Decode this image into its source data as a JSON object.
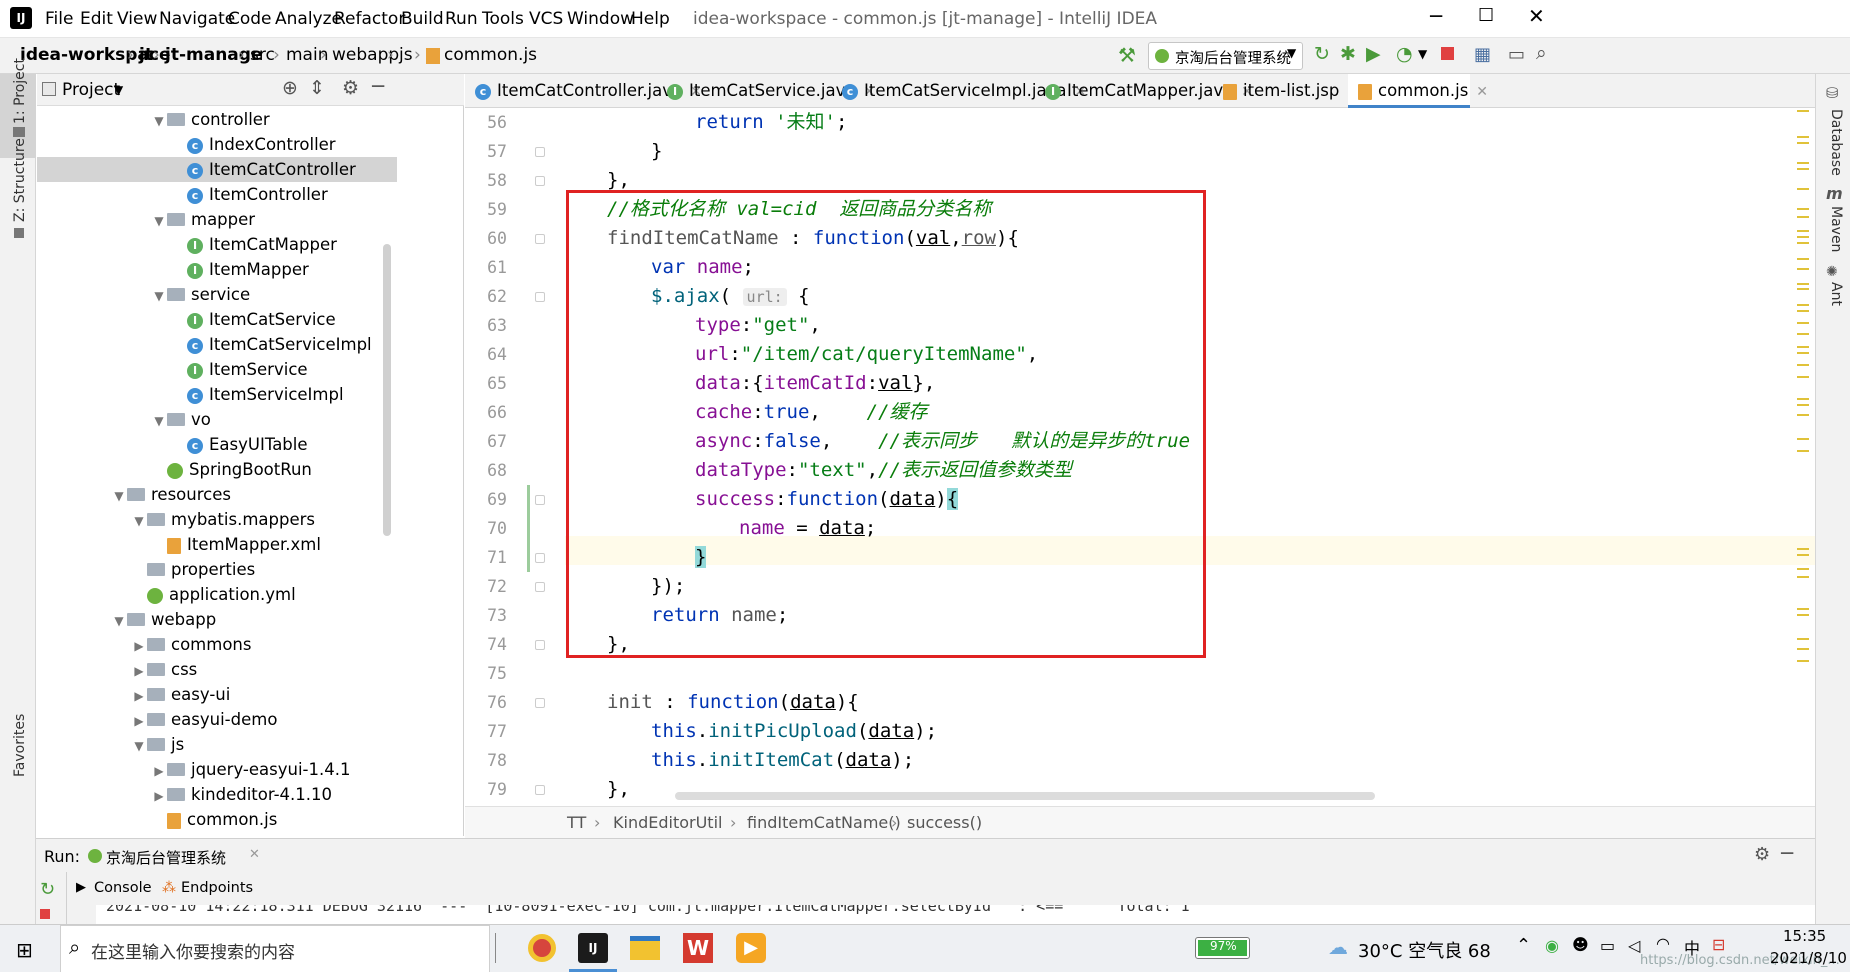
{
  "window": {
    "title": "idea-workspace - common.js [jt-manage] - IntelliJ IDEA",
    "menu": [
      "File",
      "Edit",
      "View",
      "Navigate",
      "Code",
      "Analyze",
      "Refactor",
      "Build",
      "Run",
      "Tools",
      "VCS",
      "Window",
      "Help"
    ]
  },
  "navbar": {
    "crumbs": [
      "idea-workspace",
      "jt",
      "jt-manage",
      "src",
      "main",
      "webapp",
      "js",
      "common.js"
    ],
    "run_config": "京淘后台管理系统"
  },
  "left_strip": {
    "project": "1: Project",
    "structure": "Z: Structure",
    "favorites": "Favorites"
  },
  "project_panel": {
    "title": "Project",
    "tree": [
      {
        "label": "controller",
        "icon": "folder",
        "depth": 3,
        "arrow": "▼"
      },
      {
        "label": "IndexController",
        "icon": "class",
        "depth": 4
      },
      {
        "label": "ItemCatController",
        "icon": "class",
        "depth": 4,
        "selected": true
      },
      {
        "label": "ItemController",
        "icon": "class",
        "depth": 4
      },
      {
        "label": "mapper",
        "icon": "folder",
        "depth": 3,
        "arrow": "▼"
      },
      {
        "label": "ItemCatMapper",
        "icon": "interface",
        "depth": 4
      },
      {
        "label": "ItemMapper",
        "icon": "interface",
        "depth": 4
      },
      {
        "label": "service",
        "icon": "folder",
        "depth": 3,
        "arrow": "▼"
      },
      {
        "label": "ItemCatService",
        "icon": "interface",
        "depth": 4
      },
      {
        "label": "ItemCatServiceImpl",
        "icon": "class",
        "depth": 4
      },
      {
        "label": "ItemService",
        "icon": "interface",
        "depth": 4
      },
      {
        "label": "ItemServiceImpl",
        "icon": "class",
        "depth": 4
      },
      {
        "label": "vo",
        "icon": "folder",
        "depth": 3,
        "arrow": "▼"
      },
      {
        "label": "EasyUITable",
        "icon": "class",
        "depth": 4
      },
      {
        "label": "SpringBootRun",
        "icon": "spring",
        "depth": 3
      },
      {
        "label": "resources",
        "icon": "folder",
        "depth": 1,
        "arrow": "▼"
      },
      {
        "label": "mybatis.mappers",
        "icon": "folder",
        "depth": 2,
        "arrow": "▼"
      },
      {
        "label": "ItemMapper.xml",
        "icon": "file",
        "depth": 3
      },
      {
        "label": "properties",
        "icon": "folder",
        "depth": 2
      },
      {
        "label": "application.yml",
        "icon": "spring",
        "depth": 2
      },
      {
        "label": "webapp",
        "icon": "folder",
        "depth": 1,
        "arrow": "▼"
      },
      {
        "label": "commons",
        "icon": "folder",
        "depth": 2,
        "arrow": "▶"
      },
      {
        "label": "css",
        "icon": "folder",
        "depth": 2,
        "arrow": "▶"
      },
      {
        "label": "easy-ui",
        "icon": "folder",
        "depth": 2,
        "arrow": "▶"
      },
      {
        "label": "easyui-demo",
        "icon": "folder",
        "depth": 2,
        "arrow": "▶"
      },
      {
        "label": "js",
        "icon": "folder",
        "depth": 2,
        "arrow": "▼"
      },
      {
        "label": "jquery-easyui-1.4.1",
        "icon": "folder",
        "depth": 3,
        "arrow": "▶"
      },
      {
        "label": "kindeditor-4.1.10",
        "icon": "folder",
        "depth": 3,
        "arrow": "▶"
      },
      {
        "label": "common.js",
        "icon": "file",
        "depth": 3
      }
    ]
  },
  "tabs": [
    {
      "label": "ItemCatController.java",
      "icon": "class"
    },
    {
      "label": "ItemCatService.java",
      "icon": "interface"
    },
    {
      "label": "ItemCatServiceImpl.java",
      "icon": "class"
    },
    {
      "label": "ItemCatMapper.java",
      "icon": "interface"
    },
    {
      "label": "item-list.jsp",
      "icon": "file"
    },
    {
      "label": "common.js",
      "icon": "file",
      "active": true
    }
  ],
  "line_numbers": [
    "56",
    "57",
    "58",
    "59",
    "60",
    "61",
    "62",
    "63",
    "64",
    "65",
    "66",
    "67",
    "68",
    "69",
    "70",
    "71",
    "72",
    "73",
    "74",
    "75",
    "76",
    "77",
    "78",
    "79"
  ],
  "code": {
    "l56a": "return ",
    "l56b": "'未知'",
    "l56c": ";",
    "l57": "}",
    "l58": "},",
    "l59": "//格式化名称 val=cid  返回商品分类名称",
    "l60a": "findItemCatName",
    "l60b": " : ",
    "l60c": "function",
    "l60d": "(",
    "l60e": "val",
    "l60f": ",",
    "l60g": "row",
    "l60h": "){",
    "l61a": "var ",
    "l61b": "name",
    "l61c": ";",
    "l62a": "$.",
    "l62b": "ajax",
    "l62c": "( ",
    "l62d": "url:",
    "l62e": " {",
    "l63a": "type",
    "l63b": ":",
    "l63c": "\"get\"",
    "l63d": ",",
    "l64a": "url",
    "l64b": ":",
    "l64c": "\"/item/cat/queryItemName\"",
    "l64d": ",",
    "l65a": "data",
    "l65b": ":{",
    "l65c": "itemCatId",
    "l65d": ":",
    "l65e": "val",
    "l65f": "},",
    "l66a": "cache",
    "l66b": ":",
    "l66c": "true",
    "l66d": ",    ",
    "l66e": "//缓存",
    "l67a": "async",
    "l67b": ":",
    "l67c": "false",
    "l67d": ",    ",
    "l67e": "//表示同步   默认的是异步的true",
    "l68a": "dataType",
    "l68b": ":",
    "l68c": "\"text\"",
    "l68d": ",",
    "l68e": "//表示返回值参数类型",
    "l69a": "success",
    "l69b": ":",
    "l69c": "function",
    "l69d": "(",
    "l69e": "data",
    "l69f": ")",
    "l69g": "{",
    "l70a": "name",
    "l70b": " = ",
    "l70c": "data",
    "l70d": ";",
    "l71": "}",
    "l72": "});",
    "l73a": "return ",
    "l73b": "name",
    "l73c": ";",
    "l74": "},",
    "l76a": "init",
    "l76b": " : ",
    "l76c": "function",
    "l76d": "(",
    "l76e": "data",
    "l76f": "){",
    "l77a": "this",
    "l77b": ".",
    "l77c": "initPicUpload",
    "l77d": "(",
    "l77e": "data",
    "l77f": ");",
    "l78a": "this",
    "l78b": ".",
    "l78c": "initItemCat",
    "l78d": "(",
    "l78e": "data",
    "l78f": ");",
    "l79": "},"
  },
  "editor_breadcrumb": [
    "TT",
    "KindEditorUtil",
    "findItemCatName()",
    "success()"
  ],
  "right_strip": {
    "database": "Database",
    "maven": "Maven",
    "ant": "Ant"
  },
  "run_panel": {
    "label": "Run:",
    "config": "京淘后台管理系统",
    "console_tab": "Console",
    "endpoints_tab": "Endpoints",
    "log_line": "2021-08-10 14:22:18.311 DEBUG 32116  ---  [10-8091-exec-10] com.jt.mapper.ItemCatMapper.selectById   : <==      Total: 1"
  },
  "taskbar": {
    "search_placeholder": "在这里输入你要搜索的内容",
    "battery": "97%",
    "weather": "30°C  空气良 68",
    "time": "15:35",
    "date": "2021/8/10",
    "watermark": "https://blog.csdn.net/weixin_..."
  }
}
